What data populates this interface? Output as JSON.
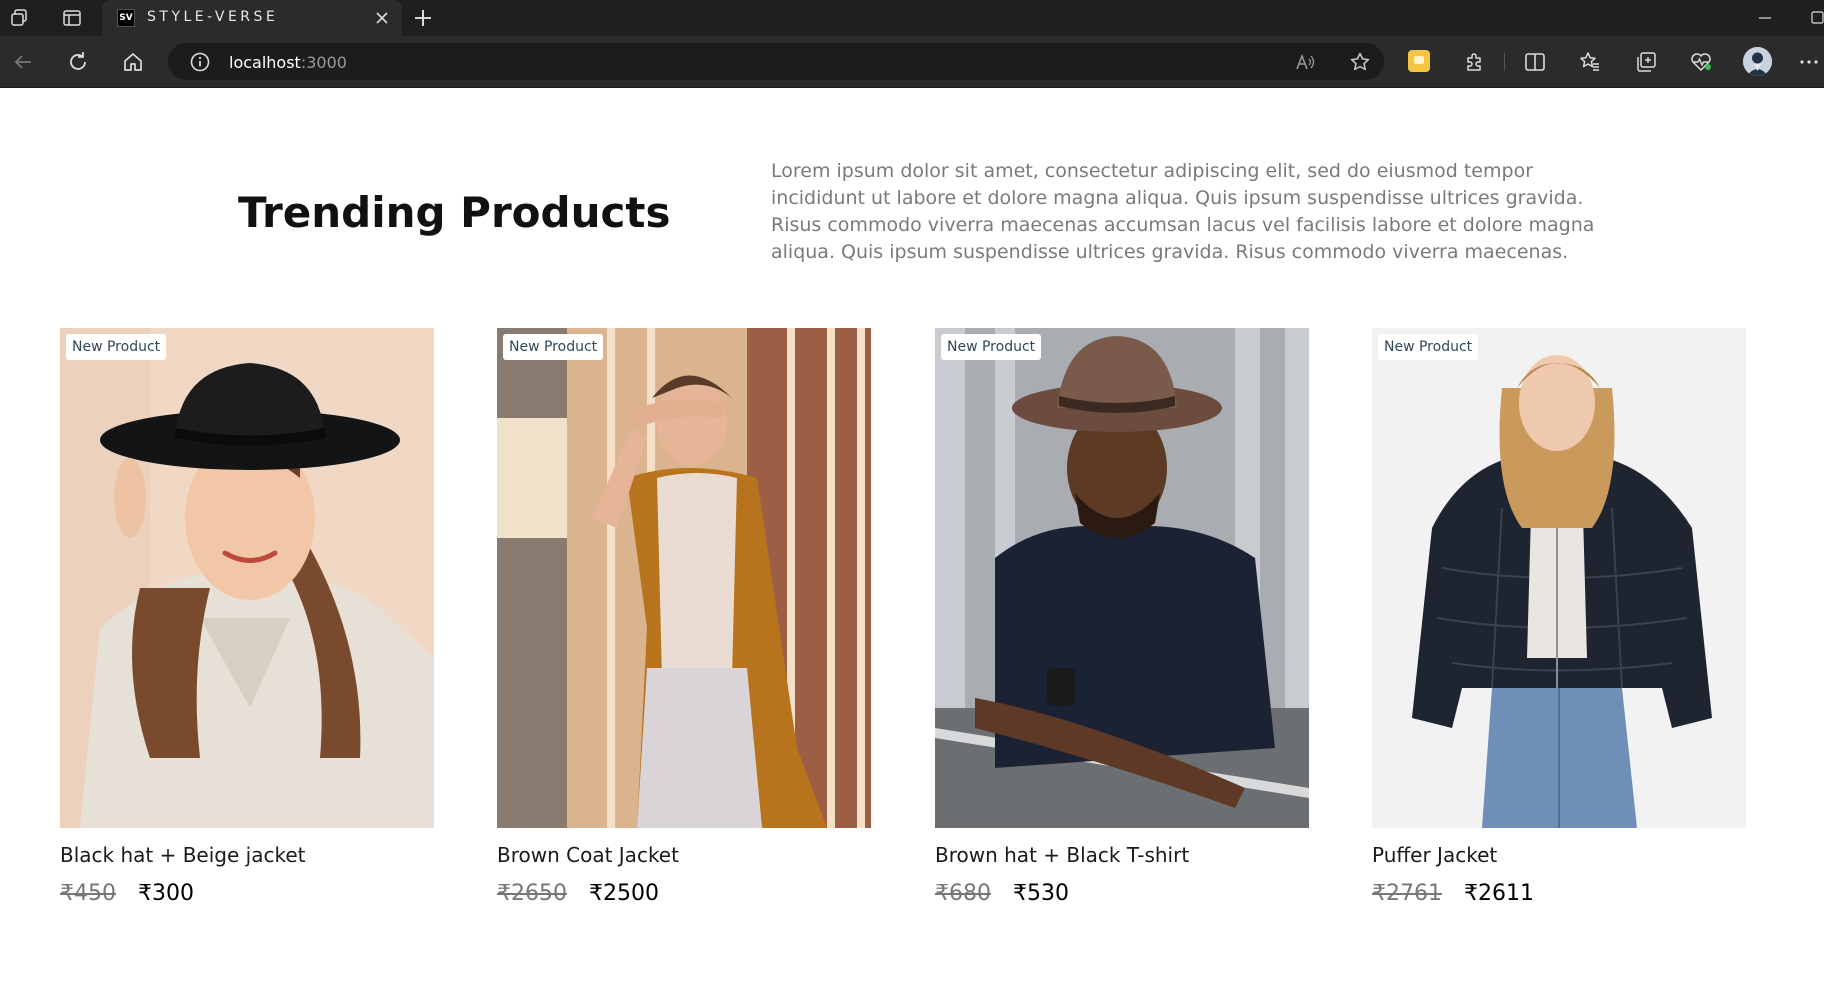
{
  "browser": {
    "tab": {
      "favicon_text": "SV",
      "title": "STYLE-VERSE"
    },
    "address": {
      "host": "localhost",
      "port": ":3000"
    },
    "icons": [
      "workspaces-icon",
      "tab-actions-icon",
      "close-icon",
      "new-tab-icon",
      "minimize-icon",
      "maximize-icon",
      "back-icon",
      "refresh-icon",
      "home-icon",
      "info-icon",
      "read-aloud-icon",
      "favorite-star-icon",
      "extensions-icon",
      "split-screen-icon",
      "favorites-icon",
      "collections-icon",
      "health-icon",
      "profile-avatar",
      "more-icon"
    ]
  },
  "section": {
    "title": "Trending Products",
    "description": "Lorem ipsum dolor sit amet, consectetur adipiscing elit, sed do eiusmod tempor incididunt ut labore et dolore magna aliqua. Quis ipsum suspendisse ultrices gravida. Risus commodo viverra maecenas accumsan lacus vel facilisis labore et dolore magna aliqua. Quis ipsum suspendisse ultrices gravida. Risus commodo viverra maecenas."
  },
  "products": [
    {
      "badge": "New Product",
      "name": "Black hat + Beige jacket",
      "old_price": "₹450",
      "price": "₹300"
    },
    {
      "badge": "New Product",
      "name": "Brown Coat Jacket",
      "old_price": "₹2650",
      "price": "₹2500"
    },
    {
      "badge": "New Product",
      "name": "Brown hat + Black T-shirt",
      "old_price": "₹680",
      "price": "₹530"
    },
    {
      "badge": "New Product",
      "name": "Puffer Jacket",
      "old_price": "₹2761",
      "price": "₹2611"
    }
  ],
  "colors": {
    "tabbar": "#1f1f1f",
    "toolbar": "#2b2b2b",
    "heading": "#111111",
    "paragraph": "#7a7a7a",
    "badge_text": "#2f4858"
  }
}
